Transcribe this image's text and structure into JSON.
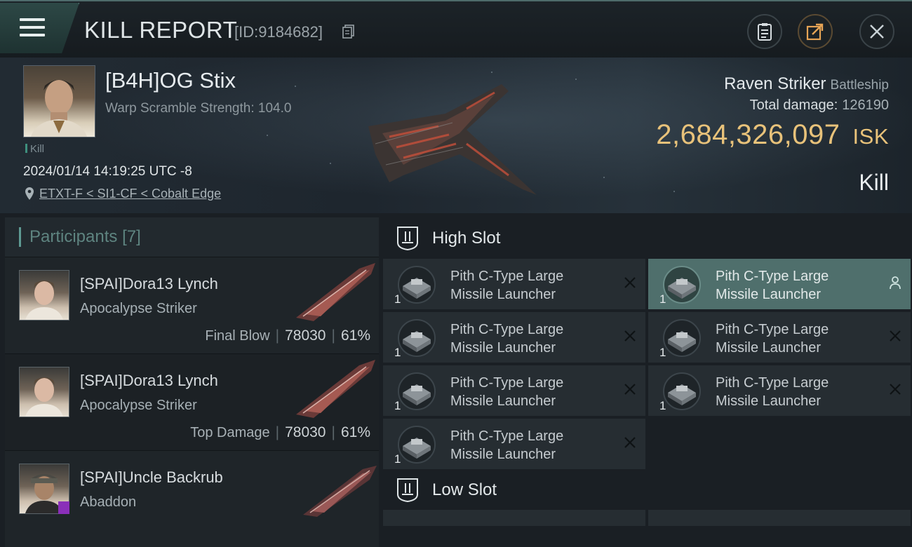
{
  "header": {
    "title": "KILL REPORT",
    "report_id": "[ID:9184682]",
    "buttons": [
      "clipboard-icon",
      "share-icon",
      "close-icon"
    ]
  },
  "victim": {
    "name": "[B4H]OG Stix",
    "warp": "Warp Scramble Strength: 104.0",
    "tag": "Kill",
    "datetime": "2024/01/14 14:19:25 UTC -8",
    "location": "ETXT-F < SI1-CF < Cobalt Edge",
    "ship": "Raven Striker",
    "ship_class": "Battleship",
    "total_damage_label": "Total damage:",
    "total_damage": "126190",
    "isk_value": "2,684,326,097",
    "isk_unit": "ISK",
    "result": "Kill"
  },
  "participants": {
    "label": "Participants",
    "count": "[7]",
    "list": [
      {
        "name": "[SPAI]Dora13 Lynch",
        "ship": "Apocalypse Striker",
        "label": "Final Blow",
        "damage": "78030",
        "percent": "61%"
      },
      {
        "name": "[SPAI]Dora13 Lynch",
        "ship": "Apocalypse Striker",
        "label": "Top Damage",
        "damage": "78030",
        "percent": "61%"
      },
      {
        "name": "[SPAI]Uncle Backrub",
        "ship": "Abaddon",
        "label": "",
        "damage": "",
        "percent": ""
      }
    ]
  },
  "slots": {
    "high_label": "High Slot",
    "low_label": "Low Slot",
    "high_modules": [
      {
        "name_line1": "Pith C-Type Large",
        "name_line2": "Missile Launcher",
        "qty": "1"
      },
      {
        "name_line1": "Pith C-Type Large",
        "name_line2": "Missile Launcher",
        "qty": "1"
      },
      {
        "name_line1": "Pith C-Type Large",
        "name_line2": "Missile Launcher",
        "qty": "1"
      },
      {
        "name_line1": "Pith C-Type Large",
        "name_line2": "Missile Launcher",
        "qty": "1"
      },
      {
        "name_line1": "Pith C-Type Large",
        "name_line2": "Missile Launcher",
        "qty": "1"
      },
      {
        "name_line1": "Pith C-Type Large",
        "name_line2": "Missile Launcher",
        "qty": "1"
      },
      {
        "name_line1": "Pith C-Type Large",
        "name_line2": "Missile Launcher",
        "qty": "1"
      }
    ]
  },
  "colors": {
    "accent": "#5e9a93",
    "isk": "#e8c27a",
    "selected": "#4f6f6c"
  }
}
